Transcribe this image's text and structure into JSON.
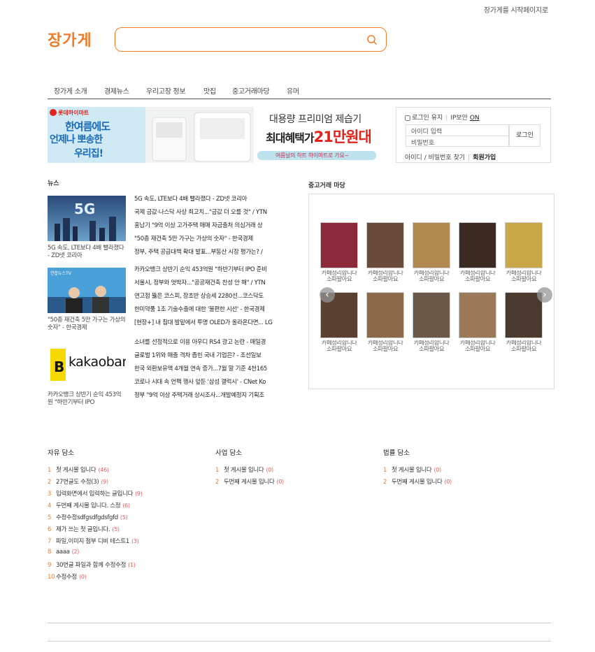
{
  "header": {
    "top_link": "장가게를 시작페이지로",
    "logo": "장가게",
    "search_placeholder": "",
    "search_icon": "search-icon"
  },
  "nav": [
    "장가게 소개",
    "경제뉴스",
    "우리고장 정보",
    "맛집",
    "중고거래마당",
    "유머"
  ],
  "banner": {
    "brand": "롯데하이마트",
    "left_text_1": "한여름에도",
    "left_text_2": "언제나 뽀송한",
    "left_text_3": "우리집!",
    "headline": "대용량 프리미엄 제습기",
    "benefit_prefix": "최대혜택가",
    "benefit_amount": "21만원대",
    "cta": "여름날의 하트 하이마트로 가요~"
  },
  "login": {
    "keep_login": "로그인 유지",
    "ip_security": "IP보안",
    "ip_on": "ON",
    "id_placeholder": "아이디 입력",
    "pw_placeholder": "비밀번호",
    "login_button": "로그인",
    "find_link": "아이디 / 비밀번호 찾기",
    "signup_link": "회원가입"
  },
  "news": {
    "title": "뉴스",
    "thumbs": [
      {
        "caption": "5G 속도, LTE보다 4배 빨라졌다 - ZD넷 코리아",
        "img_text": "5G"
      },
      {
        "caption": "\"50층 재건축 5만 가구는 가상의 숫자\" - 한국경제",
        "img_text": "연합뉴스TV"
      },
      {
        "caption": "카카오뱅크 상반기 순익 453억원 \"하반기부터 IPO",
        "img_text": "kakaobank"
      }
    ],
    "groups": [
      [
        "5G 속도, LTE보다 4배 빨라졌다 - ZD넷 코리아",
        "국제 금값·나스닥 사상 최고치...\"금값 더 오를 것\" / YTN",
        "홍남기 \"9억 이상 고가주택 매매 자금출처 의심거래 상",
        "\"50층 재건축 5만 가구는 가상의 숫자\" - 한국경제",
        "정부, 주택 공급대책 확대 발표...부동산 시장 평가는? /"
      ],
      [
        "카카오뱅크 상반기 순익 453억원 \"하반기부터 IPO 준비",
        "서울시, 정부와 엇박자...\"공공재건축 찬성 안 해\" / YTN",
        "연고점 뚫은 코스피, 장초반 상승세 2280선...코스닥도",
        "한미약품 1조 기술수출에 대한 '불편한 시선' - 한국경제",
        "[현장+] 내 침대 발밑에서 투명 OLED가 올라온다면... LG"
      ],
      [
        "소녀를 선정적으로 이용 아우디 RS4 광고 논란 - 매일경",
        "글로벌 1위와 매출 격차 좁힌 국내 기업은? - 조선일보",
        "한국 외환보유액 4개월 연속 증가...7월 말 기준 4천165",
        "코로나 시대 속 언팩 행사 앞둔 '삼성 갤럭시' - CNet Ko",
        "정부 \"9억 이상 주택거래 상시조사...개발예정지 기획조"
      ]
    ]
  },
  "used": {
    "title": "중고거래 마당",
    "item_label": "카페정리합니다 소파팔아요",
    "items": [
      {
        "label": "카페정리합니다 소파팔아요",
        "color": "#8a2a3a"
      },
      {
        "label": "카페정리합니다 소파팔아요",
        "color": "#6b4a3a"
      },
      {
        "label": "카페정리합니다 소파팔아요",
        "color": "#b08a50"
      },
      {
        "label": "카페정리합니다 소파팔아요",
        "color": "#3a2a22"
      },
      {
        "label": "카페정리합니다 소파팔아요",
        "color": "#c8a848"
      },
      {
        "label": "카페정리합니다 소파팔아요",
        "color": "#5a4030"
      },
      {
        "label": "카페정리합니다 소파팔아요",
        "color": "#8a6a48"
      },
      {
        "label": "카페정리합니다 소파팔아요",
        "color": "#6a5848"
      },
      {
        "label": "카페정리합니다 소파팔아요",
        "color": "#9a7858"
      },
      {
        "label": "카페정리합니다 소파팔아요",
        "color": "#4a3a30"
      }
    ],
    "prev_icon": "chevron-left-icon",
    "next_icon": "chevron-right-icon"
  },
  "boards": [
    {
      "title": "자유 담소",
      "items": [
        {
          "num": "1",
          "text": "첫 게시물 입니다",
          "count": "(46)"
        },
        {
          "num": "2",
          "text": "27번글도 수정(3)",
          "count": "(9)"
        },
        {
          "num": "3",
          "text": "입력화면에서 입력하는 글입니다",
          "count": "(9)"
        },
        {
          "num": "4",
          "text": "두번째 게시물 입니다. 스정",
          "count": "(6)"
        },
        {
          "num": "5",
          "text": "수정수정sdfgsdfgdsfgfd",
          "count": "(5)"
        },
        {
          "num": "6",
          "text": "제가 쓰는 첫 글입니다.",
          "count": "(5)"
        },
        {
          "num": "7",
          "text": "파일,이미지 첨부 디비 테스트1",
          "count": "(3)"
        },
        {
          "num": "8",
          "text": "aaaa",
          "count": "(2)"
        },
        {
          "num": "9",
          "text": "30번글 파일과 함께 수정수정",
          "count": "(1)"
        },
        {
          "num": "10",
          "text": "수정수정",
          "count": "(0)"
        }
      ]
    },
    {
      "title": "사업 담소",
      "items": [
        {
          "num": "1",
          "text": "첫 게시물 입니다",
          "count": "(0)"
        },
        {
          "num": "2",
          "text": "두번째 게시물 입니다",
          "count": "(0)"
        }
      ]
    },
    {
      "title": "법률 담소",
      "items": [
        {
          "num": "1",
          "text": "첫 게시물 입니다",
          "count": "(0)"
        },
        {
          "num": "2",
          "text": "두번째 게시물 입니다",
          "count": "(0)"
        }
      ]
    }
  ]
}
